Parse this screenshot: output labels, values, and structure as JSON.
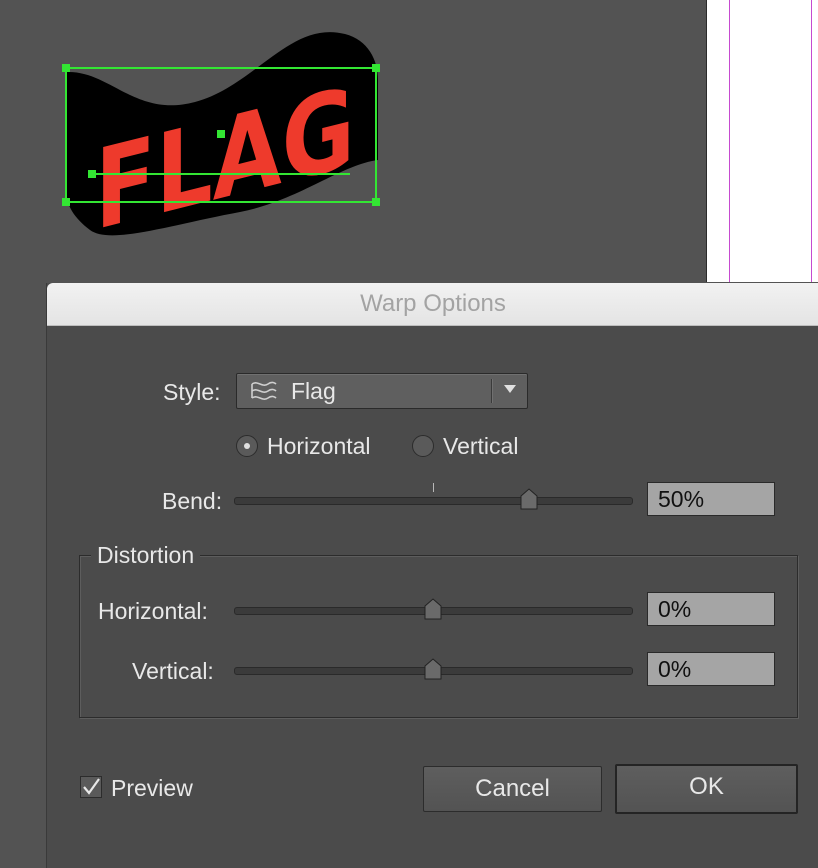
{
  "artwork": {
    "text": "FLAG"
  },
  "dialog": {
    "title": "Warp Options",
    "style_label": "Style:",
    "style_value": "Flag",
    "orientation": {
      "horizontal_label": "Horizontal",
      "vertical_label": "Vertical",
      "selected": "Horizontal"
    },
    "bend": {
      "label": "Bend:",
      "value": "50%",
      "level": 50
    },
    "distortion": {
      "title": "Distortion",
      "horizontal": {
        "label": "Horizontal:",
        "value": "0%",
        "level": 0
      },
      "vertical": {
        "label": "Vertical:",
        "value": "0%",
        "level": 0
      }
    },
    "preview": {
      "label": "Preview",
      "checked": true
    },
    "buttons": {
      "cancel": "Cancel",
      "ok": "OK"
    }
  },
  "colors": {
    "flag_text": "#ee3a2c",
    "flag_shape": "#000000",
    "selection": "#33e633",
    "guide": "#c64ad0"
  }
}
